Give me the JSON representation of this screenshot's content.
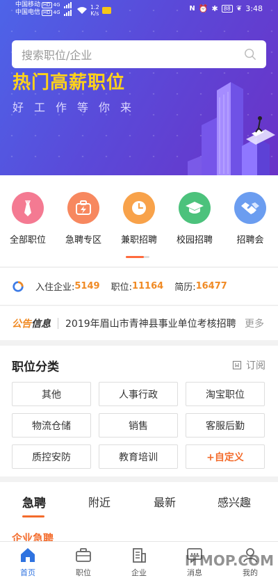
{
  "status_bar": {
    "carrier1": "中国移动",
    "carrier2": "中国电信",
    "hd": "HD",
    "net": "4G",
    "speed_value": "1.2",
    "speed_unit": "K/s",
    "battery": "88",
    "time": "3:48"
  },
  "search": {
    "placeholder": "搜索职位/企业"
  },
  "banner": {
    "headline": "热门高薪职位",
    "subline": "好工作等你来"
  },
  "categories": [
    {
      "label": "全部职位",
      "icon": "tie-icon",
      "color": "#f47a92"
    },
    {
      "label": "急聘专区",
      "icon": "briefcase-bolt-icon",
      "color": "#f7885f"
    },
    {
      "label": "兼职招聘",
      "icon": "clock-icon",
      "color": "#f8a24a"
    },
    {
      "label": "校园招聘",
      "icon": "graduation-cap-icon",
      "color": "#4cc27c"
    },
    {
      "label": "招聘会",
      "icon": "handshake-icon",
      "color": "#6b9df0"
    }
  ],
  "stats": {
    "company_label": "入住企业:",
    "company_count": "5149",
    "job_label": "职位:",
    "job_count": "11164",
    "resume_label": "简历:",
    "resume_count": "16477"
  },
  "notice": {
    "tag_a": "公告",
    "tag_b": "信息",
    "text": "2019年眉山市青神县事业单位考核招聘",
    "more": "更多"
  },
  "job_categories": {
    "title": "职位分类",
    "subscribe": "订阅",
    "items": [
      "其他",
      "人事行政",
      "淘宝职位",
      "物流仓储",
      "销售",
      "客服后勤",
      "质控安防",
      "教育培训",
      "+自定义"
    ]
  },
  "tabs": [
    "急聘",
    "附近",
    "最新",
    "感兴趣"
  ],
  "section_title": "企业急聘",
  "bottom_nav": [
    {
      "label": "首页",
      "icon": "home-icon"
    },
    {
      "label": "职位",
      "icon": "briefcase-icon"
    },
    {
      "label": "企业",
      "icon": "building-icon"
    },
    {
      "label": "消息",
      "icon": "message-icon"
    },
    {
      "label": "我的",
      "icon": "profile-icon"
    }
  ],
  "watermark": "ITMOP.COM",
  "colors": {
    "accent": "#f36b2b",
    "number": "#f08a24",
    "nav_active": "#2f73e0",
    "headline": "#ffd21a"
  }
}
